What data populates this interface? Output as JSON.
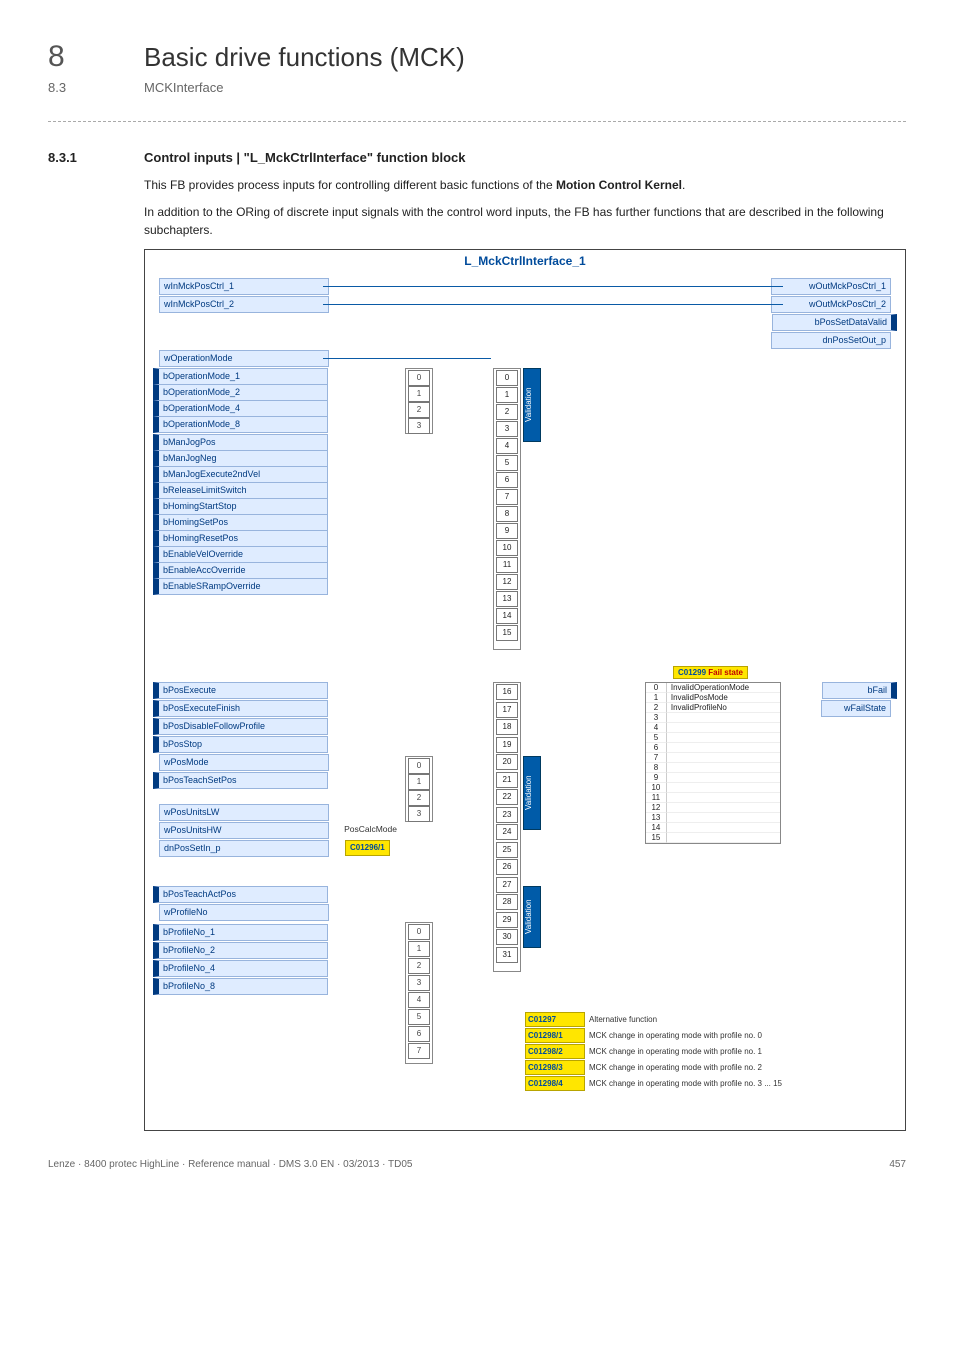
{
  "header": {
    "chapter_number": "8",
    "chapter_title": "Basic drive functions (MCK)",
    "section_number": "8.3",
    "section_title": "MCKInterface"
  },
  "subsection": {
    "number": "8.3.1",
    "title": "Control inputs | \"L_MckCtrlInterface\" function block"
  },
  "paragraphs": {
    "p1_a": "This FB provides process inputs for controlling different basic functions of the ",
    "p1_b": "Motion Control Kernel",
    "p1_c": ".",
    "p2": "In addition to the ORing of discrete input signals with the control word inputs, the FB has further functions that are described in the following subchapters."
  },
  "diagram": {
    "title": "L_MckCtrlInterface_1",
    "left_ports_word_top": [
      "wInMckPosCtrl_1",
      "wInMckPosCtrl_2"
    ],
    "left_port_opmode": "wOperationMode",
    "left_ports_bool_opmode": [
      "bOperationMode_1",
      "bOperationMode_2",
      "bOperationMode_4",
      "bOperationMode_8"
    ],
    "left_ports_bool_jog": [
      "bManJogPos",
      "bManJogNeg",
      "bManJogExecute2ndVel",
      "bReleaseLimitSwitch",
      "bHomingStartStop",
      "bHomingSetPos",
      "bHomingResetPos",
      "bEnableVelOverride",
      "bEnableAccOverride",
      "bEnableSRampOverride"
    ],
    "left_ports_bool_pos": [
      "bPosExecute",
      "bPosExecuteFinish",
      "bPosDisableFollowProfile",
      "bPosStop"
    ],
    "left_port_posmode": "wPosMode",
    "left_port_teachset": "bPosTeachSetPos",
    "left_ports_word_units": [
      "wPosUnitsLW",
      "wPosUnitsHW"
    ],
    "left_port_dn": "dnPosSetIn_p",
    "left_port_teachact": "bPosTeachActPos",
    "left_port_profile_word": "wProfileNo",
    "left_ports_bool_profile": [
      "bProfileNo_1",
      "bProfileNo_2",
      "bProfileNo_4",
      "bProfileNo_8"
    ],
    "right_ports": [
      "wOutMckPosCtrl_1",
      "wOutMckPosCtrl_2",
      "bPosSetDataValid",
      "dnPosSetOut_p"
    ],
    "right_ports_fail": [
      "bFail",
      "wFailState"
    ],
    "validation_label": "Validation",
    "opmode_mux": [
      "0",
      "1",
      "2",
      "3"
    ],
    "center_index_top": [
      "0",
      "1",
      "2",
      "3",
      "4",
      "5",
      "6",
      "7",
      "8",
      "9",
      "10",
      "11",
      "12",
      "13",
      "14",
      "15"
    ],
    "center_index_mid": [
      "16",
      "17",
      "18",
      "19",
      "20",
      "21",
      "22",
      "23",
      "24",
      "25",
      "26",
      "27",
      "28",
      "29",
      "30",
      "31"
    ],
    "posmode_mux": [
      "0",
      "1",
      "2",
      "3"
    ],
    "profile_mux": [
      "0",
      "1",
      "2",
      "3",
      "4",
      "5",
      "6",
      "7"
    ],
    "fail_header_code": "C01299",
    "fail_header_text": "Fail state",
    "fail_items": [
      "InvalidOperationMode",
      "InvalidPosMode",
      "InvalidProfileNo",
      "",
      "",
      "",
      "",
      "",
      "",
      "",
      "",
      "",
      "",
      "",
      "",
      ""
    ],
    "fail_idx": [
      "0",
      "1",
      "2",
      "3",
      "4",
      "5",
      "6",
      "7",
      "8",
      "9",
      "10",
      "11",
      "12",
      "13",
      "14",
      "15"
    ],
    "poscalcmode_label": "PosCalcMode",
    "poscalc_code": "C01296/1",
    "alt_header_code": "C01297",
    "alt_header_text": "Alternative function",
    "alt_rows": [
      {
        "code": "C01298/1",
        "text": "MCK change in operating mode with profile no. 0"
      },
      {
        "code": "C01298/2",
        "text": "MCK change in operating mode with profile no. 1"
      },
      {
        "code": "C01298/3",
        "text": "MCK change in operating mode with profile no. 2"
      },
      {
        "code": "C01298/4",
        "text": "MCK change in operating mode with profile no. 3 ... 15"
      }
    ]
  },
  "footer": {
    "left": "Lenze · 8400 protec HighLine · Reference manual · DMS 3.0 EN · 03/2013 · TD05",
    "right": "457"
  }
}
